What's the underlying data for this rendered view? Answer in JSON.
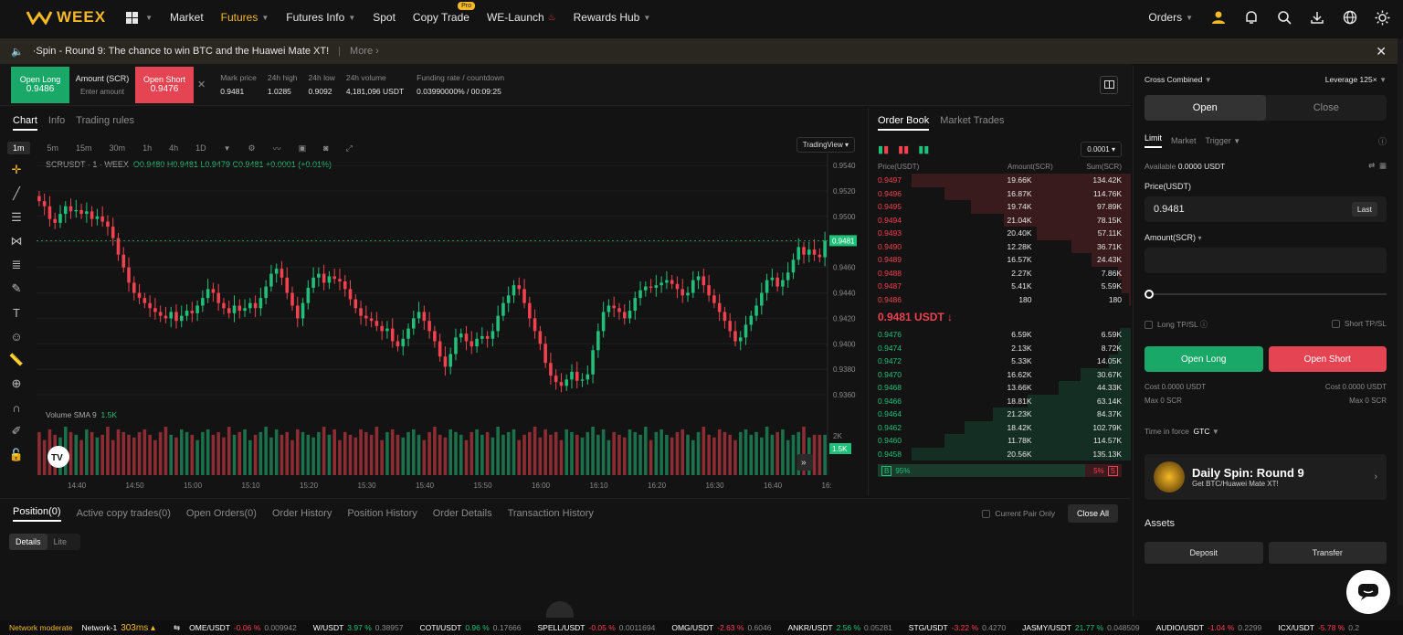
{
  "nav": {
    "logo": "WEEX",
    "items": [
      {
        "label": "Market",
        "caret": false,
        "active": false
      },
      {
        "label": "Futures",
        "caret": true,
        "active": true
      },
      {
        "label": "Futures Info",
        "caret": true,
        "active": false
      },
      {
        "label": "Spot",
        "caret": false,
        "active": false
      },
      {
        "label": "Copy Trade",
        "caret": false,
        "active": false,
        "badge": "Pro"
      },
      {
        "label": "WE-Launch",
        "caret": false,
        "active": false
      },
      {
        "label": "Rewards Hub",
        "caret": true,
        "active": false
      }
    ],
    "orders": "Orders"
  },
  "announce": {
    "text": "·Spin - Round 9: The chance to win BTC and the Huawei Mate XT!",
    "more": "More"
  },
  "ticker": {
    "open_long": "Open Long",
    "long_price": "0.9486",
    "amount_label": "Amount (SCR)",
    "amount_placeholder": "Enter amount",
    "open_short": "Open Short",
    "short_price": "0.9476",
    "stats": [
      {
        "label": "Mark price",
        "value": "0.9481"
      },
      {
        "label": "24h high",
        "value": "1.0285"
      },
      {
        "label": "24h low",
        "value": "0.9092"
      },
      {
        "label": "24h volume",
        "value": "4,181,096 USDT"
      },
      {
        "label": "Funding rate / countdown",
        "value": "0.03990000% / 00:09:25"
      }
    ]
  },
  "chart_tabs": [
    "Chart",
    "Info",
    "Trading rules"
  ],
  "timeframes": [
    "1m",
    "5m",
    "15m",
    "30m",
    "1h",
    "4h",
    "1D"
  ],
  "tradingview": "TradingView",
  "legend": {
    "symbol": "SCRUSDT · 1 · WEEX",
    "ohlc": "O0.9480 H0.9481 L0.9479 C0.9481 +0.0001 (+0.01%)"
  },
  "volume_label": "Volume SMA 9",
  "volume_value": "1.5K",
  "chart_data": {
    "type": "candlestick",
    "symbol": "SCRUSDT",
    "interval": "1m",
    "y_ticks": [
      0.954,
      0.952,
      0.95,
      0.948,
      0.946,
      0.944,
      0.942,
      0.94,
      0.938,
      0.936
    ],
    "ylim": [
      0.935,
      0.9548
    ],
    "last_price": 0.9481,
    "x_ticks": [
      "14:40",
      "14:50",
      "15:00",
      "15:10",
      "15:20",
      "15:30",
      "15:40",
      "15:50",
      "16:00",
      "16:10",
      "16:20",
      "16:30",
      "16:40",
      "16:"
    ],
    "volume_ticks": [
      "2K",
      "1.5K"
    ],
    "close": [
      0.9512,
      0.9508,
      0.9498,
      0.9495,
      0.9502,
      0.9508,
      0.9504,
      0.9505,
      0.9502,
      0.9504,
      0.9498,
      0.95,
      0.9496,
      0.9492,
      0.9483,
      0.947,
      0.946,
      0.9448,
      0.944,
      0.9436,
      0.9432,
      0.9428,
      0.9425,
      0.9422,
      0.942,
      0.9425,
      0.9418,
      0.9422,
      0.9426,
      0.9424,
      0.943,
      0.9436,
      0.9443,
      0.944,
      0.9432,
      0.9428,
      0.9424,
      0.943,
      0.9426,
      0.9428,
      0.9432,
      0.9428,
      0.9436,
      0.9445,
      0.9455,
      0.9459,
      0.9452,
      0.944,
      0.943,
      0.942,
      0.9432,
      0.9444,
      0.9452,
      0.9455,
      0.9448,
      0.9453,
      0.9451,
      0.9449,
      0.9443,
      0.9435,
      0.9428,
      0.9422,
      0.942,
      0.9418,
      0.9414,
      0.941,
      0.9412,
      0.9402,
      0.9398,
      0.9404,
      0.9412,
      0.942,
      0.9425,
      0.9418,
      0.941,
      0.9402,
      0.939,
      0.9382,
      0.9392,
      0.9405,
      0.9408,
      0.9402,
      0.9398,
      0.9404,
      0.9406,
      0.9404,
      0.941,
      0.9422,
      0.9432,
      0.9438,
      0.9446,
      0.9443,
      0.9432,
      0.942,
      0.941,
      0.94,
      0.9385,
      0.9375,
      0.937,
      0.9367,
      0.9372,
      0.9378,
      0.9371,
      0.9372,
      0.9376,
      0.9395,
      0.941,
      0.9425,
      0.943,
      0.9428,
      0.9425,
      0.942,
      0.9426,
      0.9436,
      0.9442,
      0.9445,
      0.9444,
      0.9446,
      0.9448,
      0.945,
      0.9447,
      0.9443,
      0.9438,
      0.944,
      0.945,
      0.9453,
      0.9446,
      0.9438,
      0.9432,
      0.9425,
      0.9418,
      0.941,
      0.9402,
      0.9405,
      0.9415,
      0.9422,
      0.943,
      0.944,
      0.945,
      0.9452,
      0.9445,
      0.945,
      0.9456,
      0.9466,
      0.9476,
      0.947,
      0.9474,
      0.947,
      0.9468,
      0.9481
    ],
    "volume": [
      1.6,
      1.3,
      1.7,
      1.5,
      1.4,
      1.8,
      1.6,
      1.5,
      1.3,
      1.7,
      1.6,
      1.4,
      1.5,
      1.8,
      1.3,
      1.7,
      1.6,
      1.5,
      1.4,
      1.6,
      1.7,
      1.5,
      1.3,
      1.6,
      1.8,
      1.5,
      1.4,
      1.7,
      1.6,
      1.5,
      1.3,
      1.6,
      1.7,
      1.5,
      1.6,
      1.4,
      1.8,
      1.5,
      1.6,
      1.7,
      1.3,
      1.5,
      1.6,
      1.8,
      1.4,
      1.7,
      1.5,
      1.6,
      1.3,
      1.7,
      1.6,
      1.5,
      1.4,
      1.6,
      1.8,
      1.5,
      1.7,
      1.3,
      1.6,
      1.5,
      1.4,
      1.7,
      1.6,
      1.5,
      1.8,
      1.3,
      1.6,
      1.7,
      1.5,
      1.4,
      1.6,
      1.7,
      1.5,
      1.3,
      1.6,
      1.8,
      1.5,
      1.4,
      1.7,
      1.6,
      1.5,
      1.3,
      1.6,
      1.7,
      1.5,
      1.6,
      1.4,
      1.8,
      1.5,
      1.6,
      1.7,
      1.3,
      1.5,
      1.6,
      1.8,
      1.4,
      1.7,
      1.5,
      1.6,
      1.3,
      1.7,
      1.6,
      1.5,
      1.4,
      1.6,
      1.8,
      1.5,
      1.7,
      1.3,
      1.6,
      1.5,
      1.4,
      1.7,
      1.6,
      1.5,
      1.8,
      1.3,
      1.6,
      1.7,
      1.5,
      1.4,
      1.6,
      1.7,
      1.5,
      1.3,
      1.6,
      1.8,
      1.5,
      1.4,
      1.7,
      1.6,
      1.5,
      1.3,
      1.6,
      1.7,
      1.5,
      1.6,
      1.4,
      1.8,
      1.5,
      1.6,
      1.7,
      1.3,
      1.5,
      1.6,
      1.8,
      1.4,
      1.5
    ]
  },
  "orderbook": {
    "tabs": [
      "Order Book",
      "Market Trades"
    ],
    "precision": "0.0001",
    "headers": [
      "Price(USDT)",
      "Amount(SCR)",
      "Sum(SCR)"
    ],
    "asks": [
      [
        "0.9497",
        "19.66K",
        "134.42K",
        1.0
      ],
      [
        "0.9496",
        "16.87K",
        "114.76K",
        0.85
      ],
      [
        "0.9495",
        "19.74K",
        "97.89K",
        0.73
      ],
      [
        "0.9494",
        "21.04K",
        "78.15K",
        0.58
      ],
      [
        "0.9493",
        "20.40K",
        "57.11K",
        0.43
      ],
      [
        "0.9490",
        "12.28K",
        "36.71K",
        0.27
      ],
      [
        "0.9489",
        "16.57K",
        "24.43K",
        0.18
      ],
      [
        "0.9488",
        "2.27K",
        "7.86K",
        0.06
      ],
      [
        "0.9487",
        "5.41K",
        "5.59K",
        0.04
      ],
      [
        "0.9486",
        "180",
        "180",
        0.01
      ]
    ],
    "last": "0.9481 USDT ↓",
    "bids": [
      [
        "0.9476",
        "6.59K",
        "6.59K",
        0.05
      ],
      [
        "0.9474",
        "2.13K",
        "8.72K",
        0.06
      ],
      [
        "0.9472",
        "5.33K",
        "14.05K",
        0.1
      ],
      [
        "0.9470",
        "16.62K",
        "30.67K",
        0.23
      ],
      [
        "0.9468",
        "13.66K",
        "44.33K",
        0.33
      ],
      [
        "0.9466",
        "18.81K",
        "63.14K",
        0.47
      ],
      [
        "0.9464",
        "21.23K",
        "84.37K",
        0.63
      ],
      [
        "0.9462",
        "18.42K",
        "102.79K",
        0.76
      ],
      [
        "0.9460",
        "11.78K",
        "114.57K",
        0.85
      ],
      [
        "0.9458",
        "20.56K",
        "135.13K",
        1.0
      ]
    ],
    "buy_label": "B",
    "buy_pct": "95%",
    "sell_pct": "5%",
    "sell_label": "S"
  },
  "positions": {
    "tabs": [
      "Position(0)",
      "Active copy trades(0)",
      "Open Orders(0)",
      "Order History",
      "Position History",
      "Order Details",
      "Transaction History"
    ],
    "current_pair": "Current Pair Only",
    "close_all": "Close All",
    "subtabs": [
      "Details",
      "Lite"
    ]
  },
  "trade": {
    "margin_mode": "Cross Combined",
    "leverage": "Leverage 125×",
    "open": "Open",
    "close": "Close",
    "types": [
      "Limit",
      "Market",
      "Trigger"
    ],
    "available": "Available",
    "available_value": "0.0000 USDT",
    "price_label": "Price(USDT)",
    "price_value": "0.9481",
    "last_btn": "Last",
    "amount_label": "Amount(SCR)",
    "long_tpsl": "Long TP/SL",
    "short_tpsl": "Short TP/SL",
    "open_long": "Open Long",
    "open_short": "Open Short",
    "cost_left": "Cost 0.0000 USDT",
    "cost_right": "Cost 0.0000 USDT",
    "max_left": "Max 0 SCR",
    "max_right": "Max 0 SCR",
    "tif_label": "Time in force",
    "tif_value": "GTC",
    "promo_title": "Daily Spin: Round 9",
    "promo_sub": "Get BTC/Huawei Mate XT!",
    "assets": "Assets",
    "deposit": "Deposit",
    "transfer": "Transfer"
  },
  "footer": {
    "network": "Network moderate",
    "node": "Network-1",
    "latency": "303ms",
    "tickers": [
      {
        "pair": "OME/USDT",
        "chg": "-0.06 %",
        "price": "0.009942",
        "up": false
      },
      {
        "pair": "W/USDT",
        "chg": "3.97 %",
        "price": "0.38957",
        "up": true
      },
      {
        "pair": "COTI/USDT",
        "chg": "0.96 %",
        "price": "0.17666",
        "up": true
      },
      {
        "pair": "SPELL/USDT",
        "chg": "-0.05 %",
        "price": "0.0011694",
        "up": false
      },
      {
        "pair": "OMG/USDT",
        "chg": "-2.63 %",
        "price": "0.6046",
        "up": false
      },
      {
        "pair": "ANKR/USDT",
        "chg": "2.56 %",
        "price": "0.05281",
        "up": true
      },
      {
        "pair": "STG/USDT",
        "chg": "-3.22 %",
        "price": "0.4270",
        "up": false
      },
      {
        "pair": "JASMY/USDT",
        "chg": "21.77 %",
        "price": "0.048509",
        "up": true
      },
      {
        "pair": "AUDIO/USDT",
        "chg": "-1.04 %",
        "price": "0.2299",
        "up": false
      },
      {
        "pair": "ICX/USDT",
        "chg": "-5.78 %",
        "price": "0.2",
        "up": false
      }
    ]
  },
  "colors": {
    "up": "#21c07a",
    "down": "#f0424f",
    "brand": "#f5b826"
  }
}
